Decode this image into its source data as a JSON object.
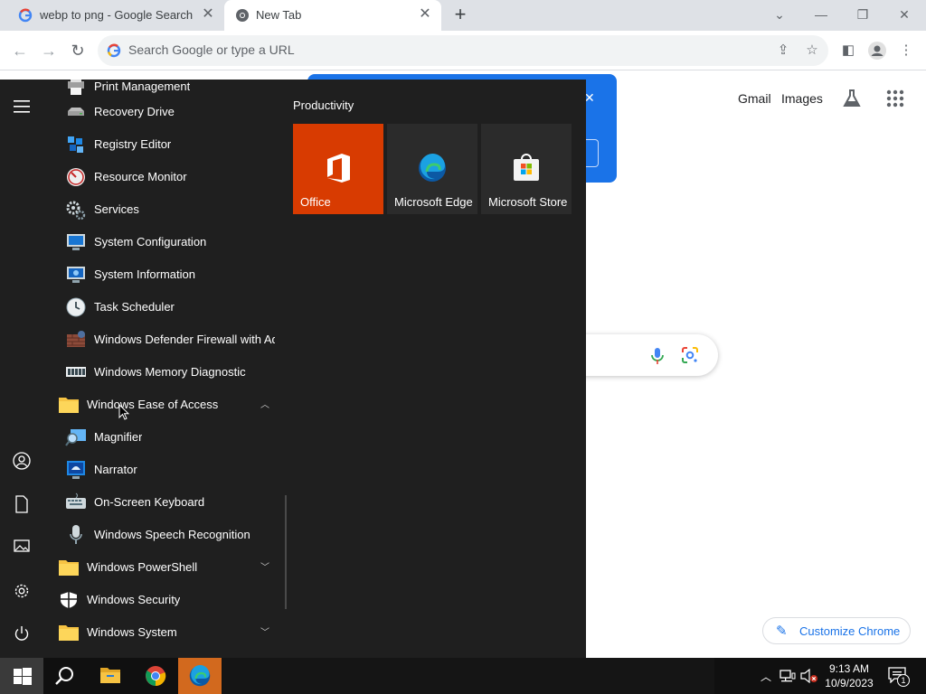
{
  "browser": {
    "tabs": [
      {
        "title": "webp to png - Google Search",
        "active": false
      },
      {
        "title": "New Tab",
        "active": true
      }
    ],
    "omnibox_placeholder": "Search Google or type a URL"
  },
  "google": {
    "nav_links": [
      "Gmail",
      "Images"
    ],
    "customize_label": "Customize Chrome"
  },
  "start_menu": {
    "apps": [
      {
        "label": "Print Management",
        "type": "app",
        "icon": "printer-icon"
      },
      {
        "label": "Recovery Drive",
        "type": "app",
        "icon": "drive-icon"
      },
      {
        "label": "Registry Editor",
        "type": "app",
        "icon": "registry-icon"
      },
      {
        "label": "Resource Monitor",
        "type": "app",
        "icon": "gauge-icon"
      },
      {
        "label": "Services",
        "type": "app",
        "icon": "gears-icon"
      },
      {
        "label": "System Configuration",
        "type": "app",
        "icon": "monitor-icon"
      },
      {
        "label": "System Information",
        "type": "app",
        "icon": "monitor-info-icon"
      },
      {
        "label": "Task Scheduler",
        "type": "app",
        "icon": "clock-icon"
      },
      {
        "label": "Windows Defender Firewall with Ad...",
        "type": "app",
        "icon": "firewall-icon"
      },
      {
        "label": "Windows Memory Diagnostic",
        "type": "app",
        "icon": "memory-chip-icon"
      },
      {
        "label": "Windows Ease of Access",
        "type": "folder",
        "expanded": true
      },
      {
        "label": "Magnifier",
        "type": "app",
        "icon": "magnifier-icon"
      },
      {
        "label": "Narrator",
        "type": "app",
        "icon": "narrator-icon"
      },
      {
        "label": "On-Screen Keyboard",
        "type": "app",
        "icon": "keyboard-icon"
      },
      {
        "label": "Windows Speech Recognition",
        "type": "app",
        "icon": "microphone-icon"
      },
      {
        "label": "Windows PowerShell",
        "type": "folder",
        "expanded": false
      },
      {
        "label": "Windows Security",
        "type": "app",
        "icon": "shield-icon"
      },
      {
        "label": "Windows System",
        "type": "folder",
        "expanded": false
      }
    ],
    "group_title": "Productivity",
    "tiles": [
      {
        "label": "Office",
        "color": "#d83b01"
      },
      {
        "label": "Microsoft Edge",
        "color": "#2b2b2b"
      },
      {
        "label": "Microsoft Store",
        "color": "#2b2b2b"
      }
    ]
  },
  "taskbar": {
    "time": "9:13 AM",
    "date": "10/9/2023",
    "notification_count": "1"
  },
  "colors": {
    "start_bg": "#1f1f1f",
    "office_orange": "#d83b01",
    "google_blue": "#1a73e8",
    "taskbar_bg": "#101010"
  }
}
